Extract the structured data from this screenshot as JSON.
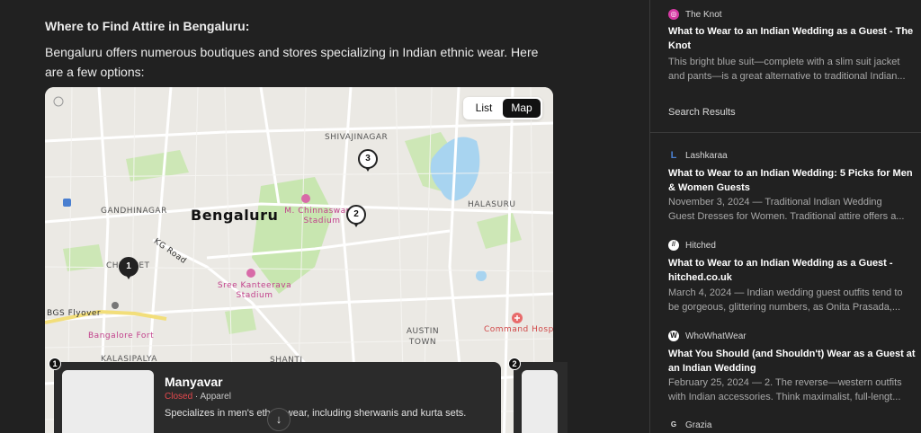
{
  "main": {
    "heading": "Where to Find Attire in Bengaluru:",
    "paragraph": "Bengaluru offers numerous boutiques and stores specializing in Indian ethnic wear. Here are a few options:"
  },
  "map": {
    "toggle": {
      "list_label": "List",
      "map_label": "Map",
      "active": "Map"
    },
    "labels": {
      "city": "Bengaluru",
      "shivajinagar": "SHIVAJINAGAR",
      "gandhinagar": "GANDHINAGAR",
      "halasuru": "HALASURU",
      "chickpet": "CHICKPET",
      "kg_road": "KG Road",
      "stadium": "M. Chinnaswamy Stadium",
      "kanteerava": "Sree Kanteerava Stadium",
      "bgs_flyover": "BGS Flyover",
      "bangalore_fort": "Bangalore Fort",
      "command_hospital": "Command Hospital",
      "austin_town": "AUSTIN TOWN",
      "shanti": "SHANTI",
      "kalasipalya": "KALASIPALYA"
    },
    "pins": [
      "1",
      "2",
      "3"
    ]
  },
  "place_card": {
    "number": "1",
    "name": "Manyavar",
    "status": "Closed",
    "separator": " · ",
    "category": "Apparel",
    "description": "Specializes in men's ethnic wear, including sherwanis and kurta sets.",
    "next_number": "2"
  },
  "sidebar": {
    "top_result": {
      "source": "The Knot",
      "title": "What to Wear to an Indian Wedding as a Guest - The Knot",
      "snippet_1": "This bright blue suit—complete with a slim suit jacket",
      "snippet_2": "and pants—is a great alternative to traditional Indian..."
    },
    "search_results_label": "Search Results",
    "results": [
      {
        "source": "Lashkaraa",
        "icon_glyph": "L",
        "title": "What to Wear to an Indian Wedding: 5 Picks for Men & Women Guests",
        "snippet_1": "November 3, 2024 — Traditional Indian Wedding",
        "snippet_2": "Guest Dresses for Women. Traditional attire offers a..."
      },
      {
        "source": "Hitched",
        "icon_glyph": "//",
        "title": "What to Wear to an Indian Wedding as a Guest - hitched.co.uk",
        "snippet_1": "March 4, 2024 — Indian wedding guest outfits tend to",
        "snippet_2": "be gorgeous, glittering numbers, as Onita Prasada,..."
      },
      {
        "source": "WhoWhatWear",
        "icon_glyph": "W",
        "title": "What You Should (and Shouldn't) Wear as a Guest at an Indian Wedding",
        "snippet_1": "February 25, 2024 — 2. The reverse—western outfits",
        "snippet_2": "with Indian accessories. Think maximalist, full-lengt..."
      },
      {
        "source": "Grazia",
        "icon_glyph": "G"
      }
    ]
  },
  "colors": {
    "background": "#212121",
    "knot_brand": "#d63aa4",
    "closed": "#e5484d",
    "map_park": "#c8e6b0",
    "map_water": "#a8d4f0"
  }
}
